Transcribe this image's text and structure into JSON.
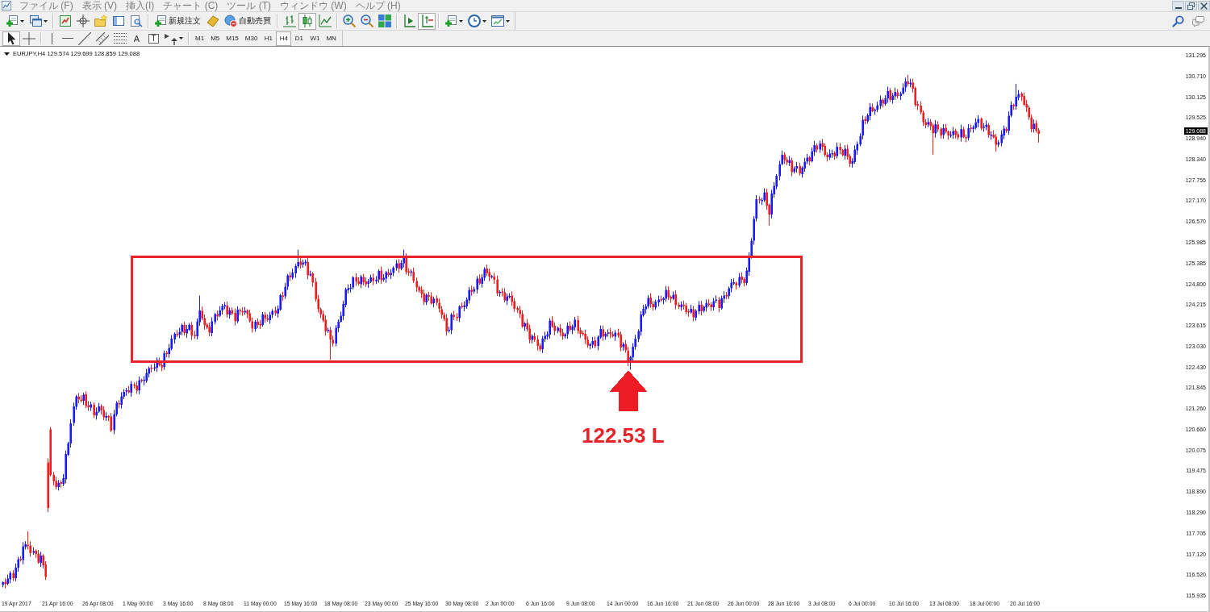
{
  "menu": {
    "items": [
      "ファイル (F)",
      "表示 (V)",
      "挿入(I)",
      "チャート (C)",
      "ツール (T)",
      "ウィンドウ (W)",
      "ヘルプ (H)"
    ]
  },
  "window_controls": [
    {
      "kind": "minimize"
    },
    {
      "kind": "restore"
    },
    {
      "kind": "close"
    }
  ],
  "toolbar": {
    "groups": [
      [
        {
          "kind": "newchart",
          "dropdown": true
        },
        {
          "kind": "profiles",
          "dropdown": true
        }
      ],
      [
        {
          "kind": "marketwatch"
        },
        {
          "kind": "datawindow"
        },
        {
          "kind": "navigator"
        },
        {
          "kind": "terminal"
        },
        {
          "kind": "tester"
        }
      ],
      [
        {
          "kind": "order",
          "label": "新規注文"
        },
        {
          "kind": "editor"
        },
        {
          "kind": "autotrading",
          "label": "自動売買"
        }
      ],
      [
        {
          "kind": "bars",
          "selected": false
        },
        {
          "kind": "candles",
          "selected": true
        },
        {
          "kind": "line",
          "selected": false
        }
      ],
      [
        {
          "kind": "zoomin"
        },
        {
          "kind": "zoomout"
        },
        {
          "kind": "tile"
        }
      ],
      [
        {
          "kind": "shift",
          "selected": false
        },
        {
          "kind": "autoscroll",
          "selected": true
        }
      ],
      [
        {
          "kind": "indicators",
          "dropdown": true
        },
        {
          "kind": "periods",
          "dropdown": true
        },
        {
          "kind": "templates",
          "dropdown": true
        }
      ]
    ],
    "right": [
      {
        "kind": "search"
      },
      {
        "kind": "chat"
      }
    ]
  },
  "drawing_toolbar": {
    "groups": [
      [
        {
          "kind": "cursor",
          "selected": true
        },
        {
          "kind": "crosshair",
          "selected": false
        }
      ],
      [
        {
          "kind": "vline"
        },
        {
          "kind": "hline"
        },
        {
          "kind": "trendline"
        },
        {
          "kind": "channel"
        },
        {
          "kind": "fibo"
        },
        {
          "kind": "text",
          "label": "A"
        },
        {
          "kind": "label",
          "label": "T"
        },
        {
          "kind": "arrows",
          "dropdown": true
        }
      ]
    ]
  },
  "timeframes": [
    {
      "label": "M1",
      "selected": false
    },
    {
      "label": "M5",
      "selected": false
    },
    {
      "label": "M15",
      "selected": false
    },
    {
      "label": "M30",
      "selected": false
    },
    {
      "label": "H1",
      "selected": false
    },
    {
      "label": "H4",
      "selected": true
    },
    {
      "label": "D1",
      "selected": false
    },
    {
      "label": "W1",
      "selected": false
    },
    {
      "label": "MN",
      "selected": false
    }
  ],
  "chart": {
    "title": "EURJPY,H4 129.574 129.699 128.859 129.088",
    "current_price": "129.088",
    "price_labels": [
      "131.295",
      "130.710",
      "130.125",
      "129.525",
      "128.940",
      "128.340",
      "127.755",
      "127.170",
      "126.570",
      "125.985",
      "125.385",
      "124.800",
      "124.215",
      "123.615",
      "123.030",
      "122.430",
      "121.845",
      "121.260",
      "120.660",
      "120.075",
      "119.475",
      "118.890",
      "118.290",
      "117.705",
      "117.120",
      "116.520",
      "115.935"
    ],
    "time_labels": [
      "19 Apr 2017",
      "21 Apr 16:00",
      "26 Apr 08:00",
      "1 May 00:00",
      "3 May 16:00",
      "8 May 08:00",
      "11 May 00:00",
      "15 May 16:00",
      "18 May 08:00",
      "23 May 00:00",
      "25 May 16:00",
      "30 May 08:00",
      "2 Jun 00:00",
      "6 Jun 16:00",
      "9 Jun 08:00",
      "14 Jun 00:00",
      "16 Jun 16:00",
      "21 Jun 08:00",
      "26 Jun 00:00",
      "28 Jun 16:00",
      "3 Jul 08:00",
      "6 Jul 00:00",
      "10 Jul 16:00",
      "13 Jul 08:00",
      "18 Jul 00:00",
      "20 Jul 16:00"
    ],
    "annotation": {
      "label": "122.53 L"
    }
  }
}
